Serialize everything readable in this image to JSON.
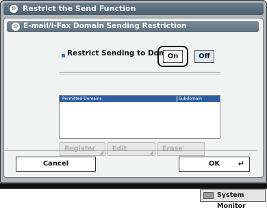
{
  "window": {
    "title": "Restrict the Send Function"
  },
  "dialog": {
    "title": "E-mail/I-Fax Domain Sending Restriction",
    "restrict_label": "Restrict Sending to Domains",
    "toggle": {
      "on_label": "On",
      "off_label": "Off",
      "selected": "On"
    },
    "table": {
      "columns": [
        "Permitted Domains",
        "Subdomain"
      ],
      "rows": []
    },
    "actions": {
      "register": "Register",
      "edit": "Edit",
      "erase": "Erase"
    },
    "cancel": "Cancel",
    "ok": "OK"
  },
  "status_bar": {
    "system_monitor": "System Monitor"
  },
  "colors": {
    "title_bar": "#4d5f6e",
    "table_header": "#2e5da2",
    "off_button": "#dce9f3",
    "disabled_text": "#b0b0b0"
  },
  "icons": {
    "window": "function-settings-icon",
    "dialog": "function-settings-icon",
    "ok": "enter-arrow-icon",
    "action_menu": "corner-triangle-icon"
  }
}
